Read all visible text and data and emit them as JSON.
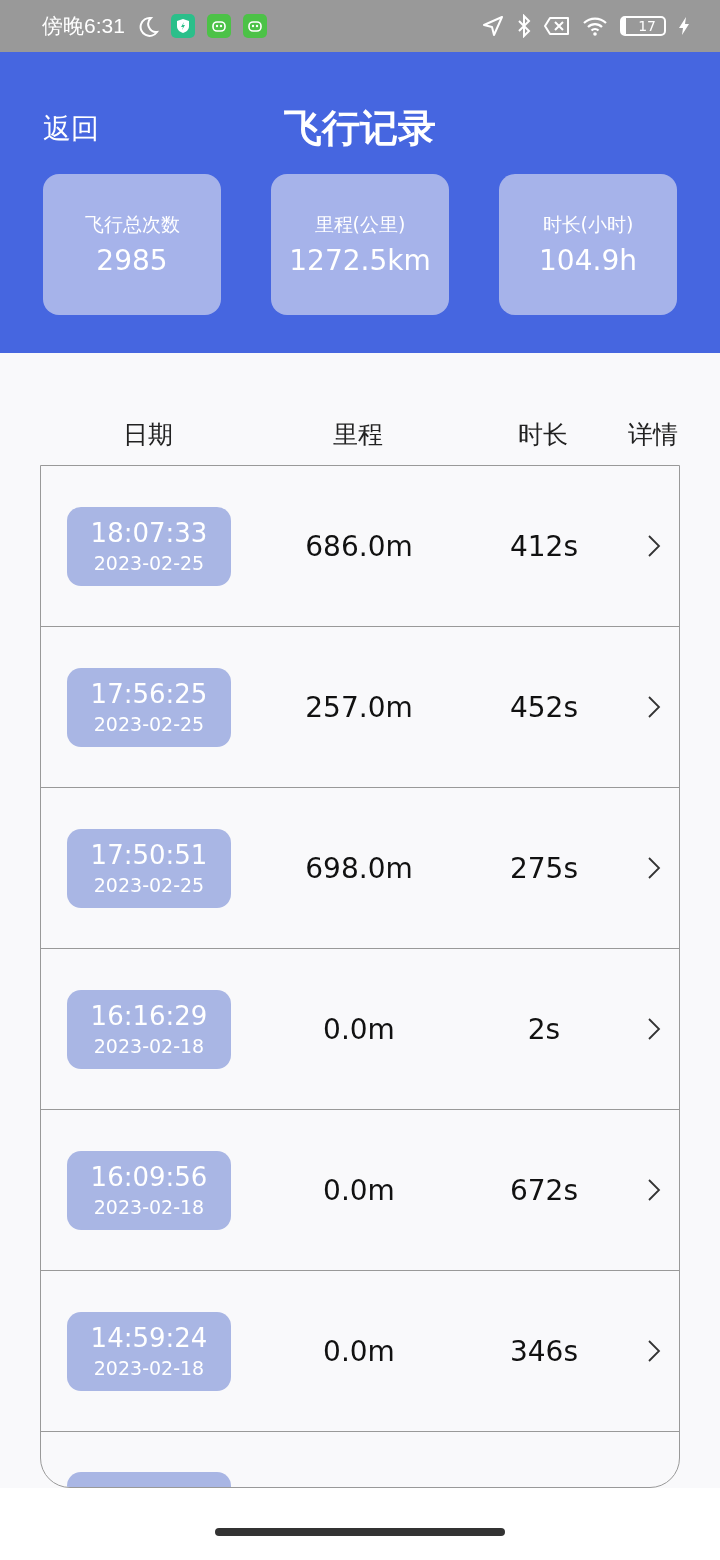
{
  "status_bar": {
    "time": "傍晚6:31",
    "battery": "17"
  },
  "header": {
    "back": "返回",
    "title": "飞行记录"
  },
  "stats": [
    {
      "label": "飞行总次数",
      "value": "2985"
    },
    {
      "label": "里程(公里)",
      "value": "1272.5km"
    },
    {
      "label": "时长(小时)",
      "value": "104.9h"
    }
  ],
  "table": {
    "columns": [
      "日期",
      "里程",
      "时长",
      "详情"
    ],
    "rows": [
      {
        "time": "18:07:33",
        "date": "2023-02-25",
        "distance": "686.0m",
        "duration": "412s"
      },
      {
        "time": "17:56:25",
        "date": "2023-02-25",
        "distance": "257.0m",
        "duration": "452s"
      },
      {
        "time": "17:50:51",
        "date": "2023-02-25",
        "distance": "698.0m",
        "duration": "275s"
      },
      {
        "time": "16:16:29",
        "date": "2023-02-18",
        "distance": "0.0m",
        "duration": "2s"
      },
      {
        "time": "16:09:56",
        "date": "2023-02-18",
        "distance": "0.0m",
        "duration": "672s"
      },
      {
        "time": "14:59:24",
        "date": "2023-02-18",
        "distance": "0.0m",
        "duration": "346s"
      }
    ]
  }
}
